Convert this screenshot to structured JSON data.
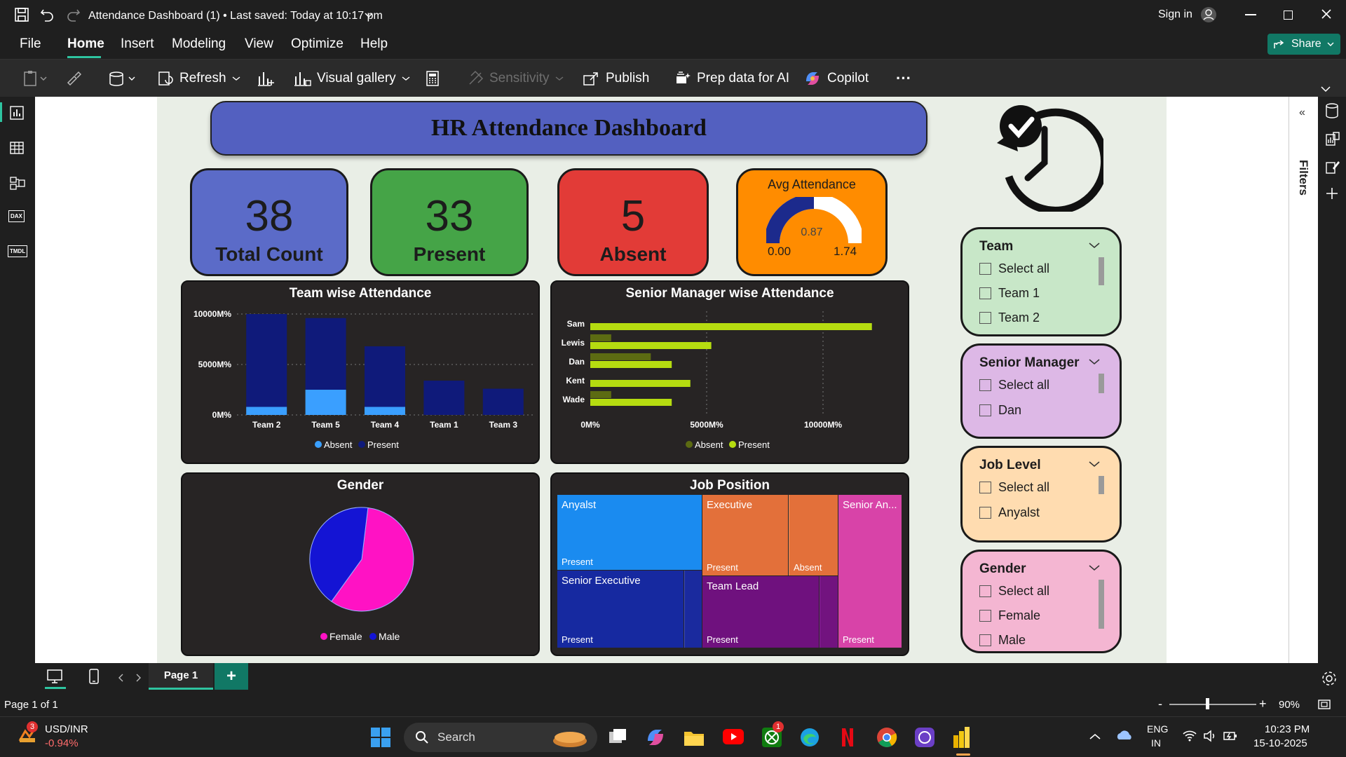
{
  "titlebar": {
    "title": "Attendance Dashboard (1) • Last saved: Today at 10:17 pm",
    "sign_in": "Sign in"
  },
  "menu": {
    "items": [
      "File",
      "Home",
      "Insert",
      "Modeling",
      "View",
      "Optimize",
      "Help"
    ],
    "active": "Home",
    "share": "Share"
  },
  "ribbon": {
    "refresh": "Refresh",
    "visual_gallery": "Visual gallery",
    "sensitivity": "Sensitivity",
    "publish": "Publish",
    "prep_data": "Prep data for AI",
    "copilot": "Copilot",
    "more": "···"
  },
  "rails": {
    "left_dax": "DAX",
    "left_tmdl": "TMDL",
    "filters_label": "Filters"
  },
  "dashboard": {
    "title": "HR Attendance Dashboard",
    "kpis": [
      {
        "value": "38",
        "label": "Total Count",
        "color": "#5b6bc8"
      },
      {
        "value": "33",
        "label": "Present",
        "color": "#45a447"
      },
      {
        "value": "5",
        "label": "Absent",
        "color": "#e23b37"
      }
    ],
    "gauge": {
      "title": "Avg Attendance",
      "value": "0.87",
      "min": "0.00",
      "max": "1.74",
      "fraction": 0.5,
      "color": "#ff8c00"
    }
  },
  "slicers": [
    {
      "title": "Team",
      "options": [
        "Select all",
        "Team 1",
        "Team 2"
      ],
      "color": "#c8e7c8"
    },
    {
      "title": "Senior Manager",
      "options": [
        "Select all",
        "Dan"
      ],
      "color": "#ddb8e6"
    },
    {
      "title": "Job Level",
      "options": [
        "Select all",
        "Anyalst"
      ],
      "color": "#ffdcb0"
    },
    {
      "title": "Gender",
      "options": [
        "Select all",
        "Female",
        "Male"
      ],
      "color": "#f4b6d2"
    }
  ],
  "treemap": {
    "title": "Job Position",
    "cells": [
      {
        "label": "Anyalst",
        "sub": "Present",
        "color": "#1a8bf0"
      },
      {
        "label": "Senior Executive",
        "sub": "Present",
        "color": "#1629a0"
      },
      {
        "label": "",
        "sub": "",
        "color": "#1a2a9e"
      },
      {
        "label": "Executive",
        "sub": "Present",
        "color": "#e3703a"
      },
      {
        "label": "",
        "sub": "Absent",
        "color": "#e3703a"
      },
      {
        "label": "Team Lead",
        "sub": "Present",
        "color": "#6f117e"
      },
      {
        "label": "",
        "sub": "",
        "color": "#72137f"
      },
      {
        "label": "Senior An...",
        "sub": "Present",
        "color": "#d843a8"
      }
    ]
  },
  "chart_data": [
    {
      "type": "bar",
      "title": "Team wise Attendance",
      "categories": [
        "Team 2",
        "Team 5",
        "Team 4",
        "Team 1",
        "Team 3"
      ],
      "series": [
        {
          "name": "Absent",
          "values": [
            800,
            2500,
            800,
            0,
            0
          ],
          "color": "#3a9fff"
        },
        {
          "name": "Present",
          "values": [
            9200,
            7100,
            6000,
            3400,
            2600
          ],
          "color": "#0f1a7a"
        }
      ],
      "ylim": [
        0,
        10000
      ],
      "yticks": [
        "0M%",
        "5000M%",
        "10000M%"
      ],
      "stacked": true,
      "legend": "bottom"
    },
    {
      "type": "bar",
      "orientation": "horizontal",
      "title": "Senior Manager wise Attendance",
      "categories": [
        "Sam",
        "Lewis",
        "Dan",
        "Kent",
        "Wade"
      ],
      "series": [
        {
          "name": "Absent",
          "values": [
            0,
            900,
            2600,
            0,
            900
          ],
          "color": "#5c6b12"
        },
        {
          "name": "Present",
          "values": [
            12100,
            5200,
            3500,
            4300,
            3500
          ],
          "color": "#b5dc10"
        }
      ],
      "xlim": [
        0,
        12500
      ],
      "xticks": [
        "0M%",
        "5000M%",
        "10000M%"
      ],
      "legend": "bottom"
    },
    {
      "type": "pie",
      "title": "Gender",
      "series": [
        {
          "name": "Female",
          "value": 58,
          "color": "#ff12c4"
        },
        {
          "name": "Male",
          "value": 42,
          "color": "#1414d4"
        }
      ],
      "legend": "bottom"
    }
  ],
  "pagebar": {
    "page": "Page 1",
    "add": "+"
  },
  "status": {
    "page_of": "Page 1 of 1",
    "zoom": "90%",
    "zoom_minus": "-",
    "zoom_plus": "+"
  },
  "taskbar": {
    "ticker": "USD/INR",
    "change": "-0.94%",
    "badge": "3",
    "search": "Search",
    "xbox_badge": "1",
    "lang1": "ENG",
    "lang2": "IN",
    "time": "10:23 PM",
    "date": "15-10-2025"
  }
}
